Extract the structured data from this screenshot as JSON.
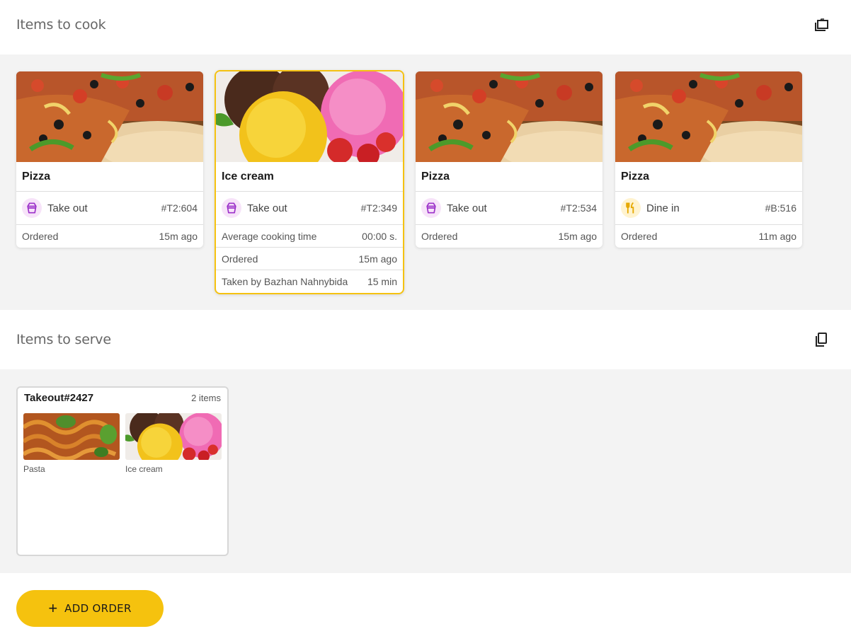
{
  "cook_section": {
    "title": "Items to cook",
    "cards": [
      {
        "name": "Pizza",
        "type": "Take out",
        "order_no": "#T2:604",
        "rows": [
          {
            "label": "Ordered",
            "value": "15m ago"
          }
        ]
      },
      {
        "name": "Ice cream",
        "type": "Take out",
        "order_no": "#T2:349",
        "rows": [
          {
            "label": "Average cooking time",
            "value": "00:00 s."
          },
          {
            "label": "Ordered",
            "value": "15m ago"
          },
          {
            "label": "Taken by Bazhan Nahnybida",
            "value": "15 min"
          }
        ]
      },
      {
        "name": "Pizza",
        "type": "Take out",
        "order_no": "#T2:534",
        "rows": [
          {
            "label": "Ordered",
            "value": "15m ago"
          }
        ]
      },
      {
        "name": "Pizza",
        "type": "Dine in",
        "order_no": "#B:516",
        "rows": [
          {
            "label": "Ordered",
            "value": "11m ago"
          }
        ]
      }
    ]
  },
  "serve_section": {
    "title": "Items to serve",
    "order": {
      "title": "Takeout#2427",
      "count": "2 items",
      "items": [
        {
          "label": "Pasta"
        },
        {
          "label": "Ice cream"
        }
      ]
    }
  },
  "add_button": {
    "label": "ADD ORDER",
    "icon": "plus-icon"
  },
  "icons": {
    "cook_header": "collapse-icon",
    "serve_header": "copy-icon",
    "takeout": "takeout-box-icon",
    "dinein": "fork-knife-icon"
  },
  "colors": {
    "accent": "#f5c20e",
    "takeout": "#9b2fc9",
    "dinein": "#e6a800",
    "panel": "#f3f3f3"
  }
}
